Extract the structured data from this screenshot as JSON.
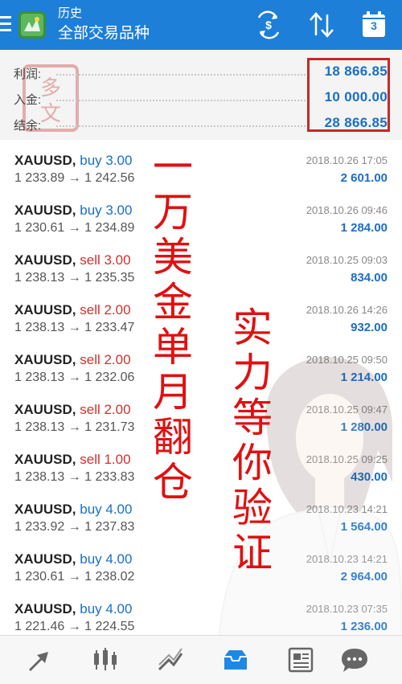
{
  "header": {
    "title": "历史",
    "subtitle": "全部交易品种",
    "calendar_day": "3",
    "icons": [
      "menu-icon",
      "app-logo-icon",
      "currency-swap-icon",
      "sort-icon",
      "calendar-icon"
    ]
  },
  "summary": {
    "profit_label": "利润:",
    "profit_value": "18 866.85",
    "deposit_label": "入金:",
    "deposit_value": "10 000.00",
    "balance_label": "结余:",
    "balance_value": "28 866.85"
  },
  "trades": [
    {
      "symbol": "XAUUSD,",
      "side": "buy 3.00",
      "prices": "1 233.89 → 1 242.56",
      "date": "2018.10.26 17:05",
      "profit": "2 601.00"
    },
    {
      "symbol": "XAUUSD,",
      "side": "buy 3.00",
      "prices": "1 230.61 → 1 234.89",
      "date": "2018.10.26 09:46",
      "profit": "1 284.00"
    },
    {
      "symbol": "XAUUSD,",
      "side": "sell 3.00",
      "prices": "1 238.13 → 1 235.35",
      "date": "2018.10.25 09:03",
      "profit": "834.00"
    },
    {
      "symbol": "XAUUSD,",
      "side": "sell 2.00",
      "prices": "1 238.13 → 1 233.47",
      "date": "2018.10.26 14:26",
      "profit": "932.00"
    },
    {
      "symbol": "XAUUSD,",
      "side": "sell 2.00",
      "prices": "1 238.13 → 1 232.06",
      "date": "2018.10.25 09:50",
      "profit": "1 214.00"
    },
    {
      "symbol": "XAUUSD,",
      "side": "sell 2.00",
      "prices": "1 238.13 → 1 231.73",
      "date": "2018.10.25 09:47",
      "profit": "1 280.00"
    },
    {
      "symbol": "XAUUSD,",
      "side": "sell 1.00",
      "prices": "1 238.13 → 1 233.83",
      "date": "2018.10.25 09:25",
      "profit": "430.00"
    },
    {
      "symbol": "XAUUSD,",
      "side": "buy 4.00",
      "prices": "1 233.92 → 1 237.83",
      "date": "2018.10.23 14:21",
      "profit": "1 564.00"
    },
    {
      "symbol": "XAUUSD,",
      "side": "buy 4.00",
      "prices": "1 230.61 → 1 238.02",
      "date": "2018.10.23 14:21",
      "profit": "2 964.00"
    },
    {
      "symbol": "XAUUSD,",
      "side": "buy 4.00",
      "prices": "1 221.46 → 1 224.55",
      "date": "2018.10.23 07:35",
      "profit": "1 236.00"
    }
  ],
  "overlay": {
    "caption_left": "一万美金单月翻仓",
    "caption_right": "实力等你验证",
    "caption_color": "#e01010",
    "stamp_text": "多文"
  },
  "bottom_nav": {
    "items": [
      "quotes-icon",
      "chart-icon",
      "trade-icon",
      "history-icon",
      "news-icon",
      "messages-icon"
    ],
    "active": "history-icon"
  },
  "colors": {
    "header": "#1e7fd8",
    "buy": "#1a6fc7",
    "sell": "#d32f2f",
    "profit": "#1a6fc7",
    "highlight_frame": "#c62828"
  }
}
